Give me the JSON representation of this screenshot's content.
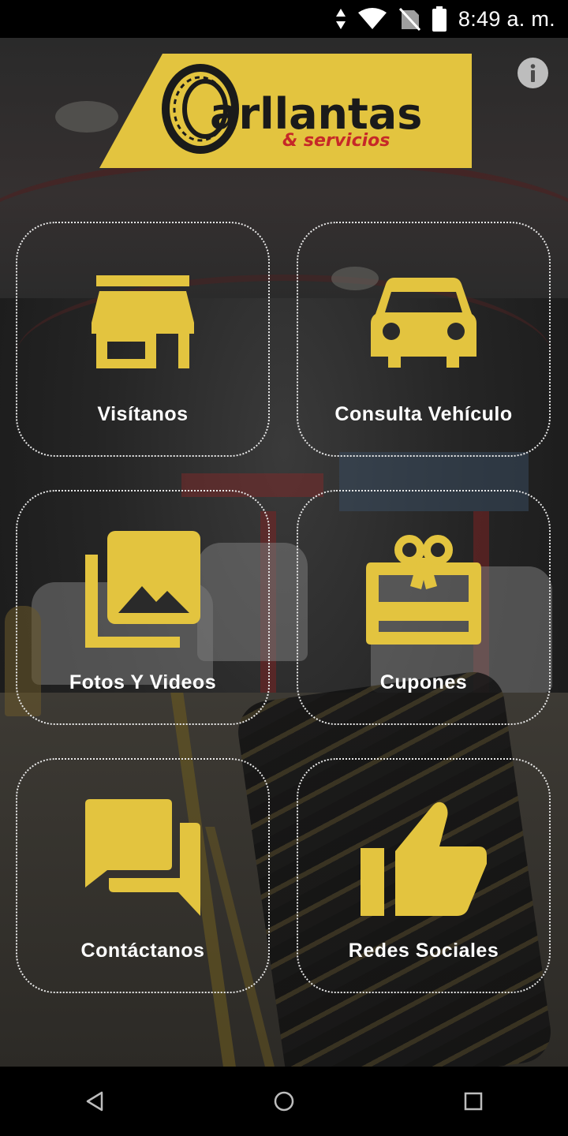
{
  "status_bar": {
    "time": "8:49 a. m.",
    "icons": [
      "data-arrows-icon",
      "wifi-icon",
      "no-signal-icon",
      "battery-icon"
    ]
  },
  "header": {
    "logo_text_main": "arllantas",
    "logo_text_sub": "& servicios",
    "logo_colors": {
      "background": "#e3c43f",
      "text": "#1a1a1a",
      "sub_text": "#c62828"
    },
    "info_icon": "info-icon"
  },
  "menu": [
    {
      "label": "Visítanos",
      "icon": "store-icon"
    },
    {
      "label": "Consulta Vehículo",
      "icon": "car-icon"
    },
    {
      "label": "Fotos Y Videos",
      "icon": "photo-library-icon"
    },
    {
      "label": "Cupones",
      "icon": "gift-card-icon"
    },
    {
      "label": "Contáctanos",
      "icon": "chat-icon"
    },
    {
      "label": "Redes Sociales",
      "icon": "thumbs-up-icon"
    }
  ],
  "accent_color": "#e3c43f",
  "nav_bar": {
    "icons": [
      "back-icon",
      "home-icon",
      "recents-icon"
    ]
  }
}
